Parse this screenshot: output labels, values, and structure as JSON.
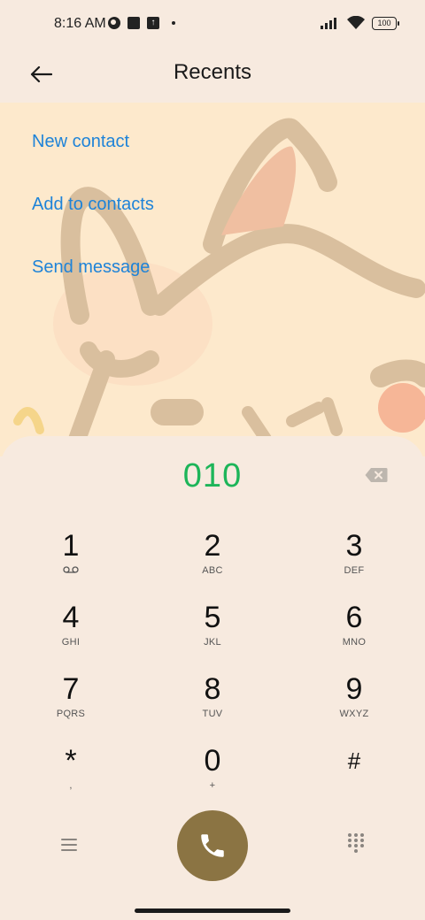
{
  "status_bar": {
    "time": "8:16 AM",
    "battery": "100"
  },
  "header": {
    "title": "Recents"
  },
  "actions": [
    {
      "label": "New contact"
    },
    {
      "label": "Add to contacts"
    },
    {
      "label": "Send message"
    }
  ],
  "dialer": {
    "number": "010",
    "keys": [
      {
        "digit": "1",
        "letters": "",
        "icon": "voicemail-icon"
      },
      {
        "digit": "2",
        "letters": "ABC"
      },
      {
        "digit": "3",
        "letters": "DEF"
      },
      {
        "digit": "4",
        "letters": "GHI"
      },
      {
        "digit": "5",
        "letters": "JKL"
      },
      {
        "digit": "6",
        "letters": "MNO"
      },
      {
        "digit": "7",
        "letters": "PQRS"
      },
      {
        "digit": "8",
        "letters": "TUV"
      },
      {
        "digit": "9",
        "letters": "WXYZ"
      },
      {
        "digit": "*",
        "letters": ","
      },
      {
        "digit": "0",
        "letters": "+"
      },
      {
        "digit": "#",
        "letters": ""
      }
    ]
  },
  "colors": {
    "accent_link": "#1E83D8",
    "number_green": "#1DB559",
    "call_button": "#8B7443",
    "background": "#F7EADF"
  }
}
